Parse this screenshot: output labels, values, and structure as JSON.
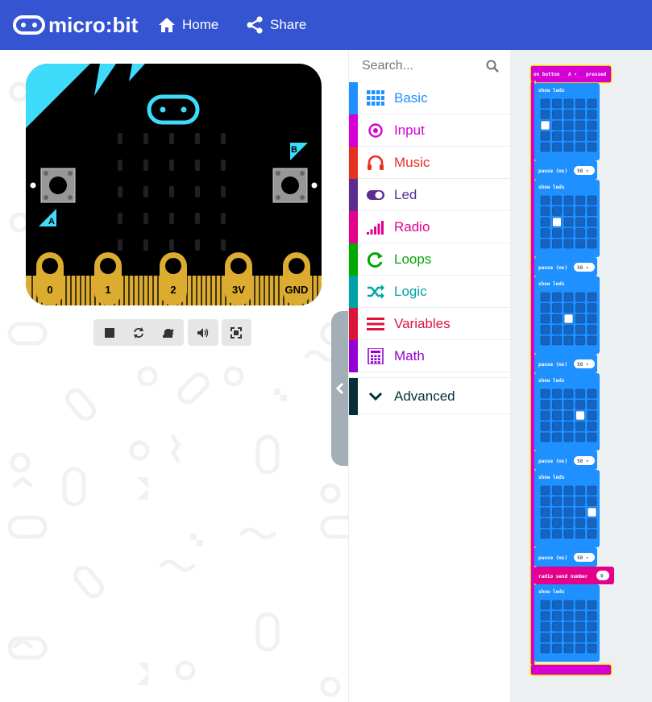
{
  "header": {
    "logo_text": "micro:bit",
    "nav": [
      {
        "label": "Home",
        "icon": "home-icon"
      },
      {
        "label": "Share",
        "icon": "share-icon"
      }
    ],
    "background": "#3454d1"
  },
  "simulator": {
    "pins": [
      "0",
      "1",
      "2",
      "3V",
      "GND"
    ],
    "button_a_label": "A",
    "button_b_label": "B",
    "board_color": "#000000",
    "accent_color": "#3fdbfb",
    "pin_color": "#dcac31",
    "controls": [
      {
        "name": "stop-button",
        "icon": "stop-icon"
      },
      {
        "name": "restart-button",
        "icon": "restart-icon"
      },
      {
        "name": "slow-motion-button",
        "icon": "snail-icon"
      },
      {
        "name": "mute-button",
        "icon": "speaker-icon"
      },
      {
        "name": "fullscreen-button",
        "icon": "fullscreen-icon"
      }
    ]
  },
  "toolbox": {
    "search_placeholder": "Search...",
    "categories": [
      {
        "label": "Basic",
        "color": "#1e90ff",
        "icon": "grid-icon"
      },
      {
        "label": "Input",
        "color": "#d400d4",
        "icon": "target-icon"
      },
      {
        "label": "Music",
        "color": "#e63022",
        "icon": "headphones-icon"
      },
      {
        "label": "Led",
        "color": "#5c2d91",
        "icon": "toggle-icon"
      },
      {
        "label": "Radio",
        "color": "#e3008c",
        "icon": "signal-bars-icon"
      },
      {
        "label": "Loops",
        "color": "#00aa00",
        "icon": "refresh-icon"
      },
      {
        "label": "Logic",
        "color": "#00a4a6",
        "icon": "shuffle-icon"
      },
      {
        "label": "Variables",
        "color": "#dc143c",
        "icon": "list-icon"
      },
      {
        "label": "Math",
        "color": "#9400d3",
        "icon": "calculator-icon"
      }
    ],
    "advanced": {
      "label": "Advanced",
      "color": "#062f3a",
      "icon": "chevron-down-icon"
    }
  },
  "workspace": {
    "event": {
      "prefix": "on button",
      "button": "A",
      "suffix": "pressed",
      "color": "#d400d4"
    },
    "show_leds_label": "show leds",
    "pause_label": "pause (ms)",
    "pause_value": "50",
    "radio_label": "radio send number",
    "radio_value": "0",
    "block_color": "#1e90ff",
    "frames": [
      {
        "lit": [
          [
            2,
            0
          ]
        ]
      },
      {
        "lit": [
          [
            2,
            1
          ]
        ]
      },
      {
        "lit": [
          [
            2,
            2
          ]
        ]
      },
      {
        "lit": [
          [
            2,
            3
          ]
        ]
      },
      {
        "lit": [
          [
            2,
            4
          ]
        ]
      },
      {
        "lit": []
      }
    ]
  }
}
